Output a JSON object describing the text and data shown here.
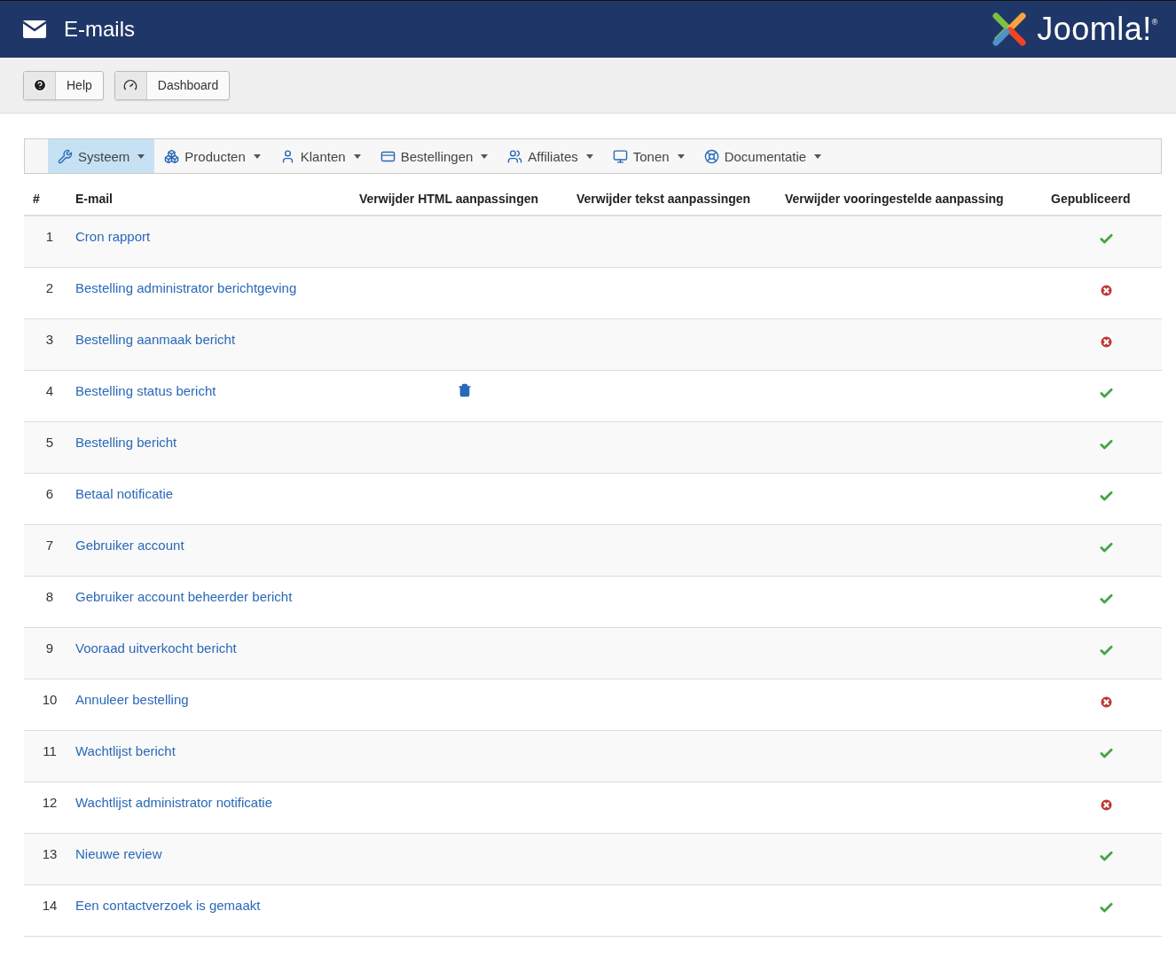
{
  "header": {
    "title": "E-mails",
    "logo_text": "Joomla!$^{®}$"
  },
  "toolbar": [
    {
      "kind": "help",
      "label": "Help"
    },
    {
      "kind": "dashboard",
      "label": "Dashboard"
    }
  ],
  "menu": [
    {
      "kind": "wrench",
      "label": "Systeem",
      "selected": true
    },
    {
      "kind": "boxes",
      "label": "Producten",
      "selected": false
    },
    {
      "kind": "user",
      "label": "Klanten",
      "selected": false
    },
    {
      "kind": "card",
      "label": "Bestellingen",
      "selected": false
    },
    {
      "kind": "users",
      "label": "Affiliates",
      "selected": false
    },
    {
      "kind": "monitor",
      "label": "Tonen",
      "selected": false
    },
    {
      "kind": "lifebuoy",
      "label": "Documentatie",
      "selected": false
    }
  ],
  "table": {
    "columns": [
      "#",
      "E-mail",
      "Verwijder HTML aanpassingen",
      "Verwijder tekst aanpassingen",
      "Verwijder vooringestelde aanpassing",
      "Gepubliceerd"
    ],
    "rows": [
      {
        "number": "1",
        "email": "Cron rapport",
        "html_override": false,
        "published": true
      },
      {
        "number": "2",
        "email": "Bestelling administrator berichtgeving",
        "html_override": false,
        "published": false
      },
      {
        "number": "3",
        "email": "Bestelling aanmaak bericht",
        "html_override": false,
        "published": false
      },
      {
        "number": "4",
        "email": "Bestelling status bericht",
        "html_override": true,
        "published": true
      },
      {
        "number": "5",
        "email": "Bestelling bericht",
        "html_override": false,
        "published": true
      },
      {
        "number": "6",
        "email": "Betaal notificatie",
        "html_override": false,
        "published": true
      },
      {
        "number": "7",
        "email": "Gebruiker account",
        "html_override": false,
        "published": true
      },
      {
        "number": "8",
        "email": "Gebruiker account beheerder bericht",
        "html_override": false,
        "published": true
      },
      {
        "number": "9",
        "email": "Vooraad uitverkocht bericht",
        "html_override": false,
        "published": true
      },
      {
        "number": "10",
        "email": "Annuleer bestelling",
        "html_override": false,
        "published": false
      },
      {
        "number": "11",
        "email": "Wachtlijst bericht",
        "html_override": false,
        "published": true
      },
      {
        "number": "12",
        "email": "Wachtlijst administrator notificatie",
        "html_override": false,
        "published": false
      },
      {
        "number": "13",
        "email": "Nieuwe review",
        "html_override": false,
        "published": true
      },
      {
        "number": "14",
        "email": "Een contactverzoek is gemaakt",
        "html_override": false,
        "published": true
      }
    ]
  }
}
